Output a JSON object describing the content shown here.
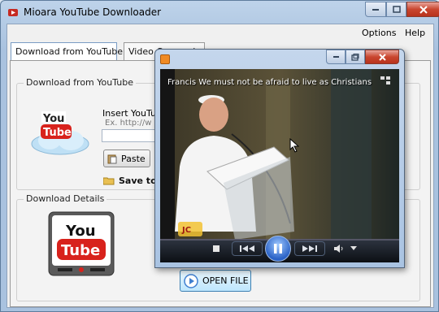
{
  "window": {
    "title": "Mioara YouTube Downloader"
  },
  "menu": {
    "items": [
      "Options",
      "Help"
    ]
  },
  "tabs": [
    {
      "label": "Download from YouTube"
    },
    {
      "label": "Video Conversion"
    }
  ],
  "download_group": {
    "title": "Download from YouTube",
    "insert_label": "Insert YouTub",
    "example_label": "Ex. http://w",
    "url_value": "",
    "paste_label": "Paste",
    "save_to_label": "Save to"
  },
  "details_group": {
    "title": "Download Details"
  },
  "open_file_label": "OPEN FILE",
  "player": {
    "video_title": "Francis We must not be afraid to live as Christians"
  },
  "colors": {
    "accent": "#3f7fd0",
    "youtube_red": "#d8221c"
  }
}
